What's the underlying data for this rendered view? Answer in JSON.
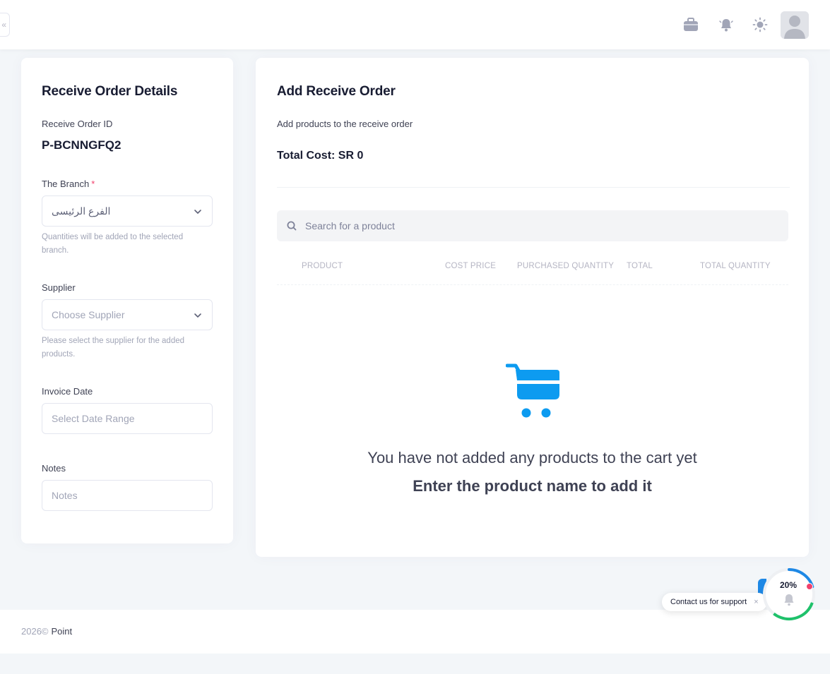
{
  "header": {
    "collapse_glyph": "«",
    "icons": [
      "briefcase-icon",
      "bell-icon",
      "sun-icon"
    ]
  },
  "details": {
    "title": "Receive Order Details",
    "order_id_label": "Receive Order ID",
    "order_id_value": "P-BCNNGFQ2",
    "branch_label": "The Branch",
    "branch_required": "*",
    "branch_value": "الفرع الرئيسى",
    "branch_hint": "Quantities will be added to the selected branch.",
    "supplier_label": "Supplier",
    "supplier_placeholder": "Choose Supplier",
    "supplier_hint": "Please select the supplier for the added products.",
    "invoice_label": "Invoice Date",
    "invoice_placeholder": "Select Date Range",
    "notes_label": "Notes",
    "notes_placeholder": "Notes"
  },
  "order": {
    "title": "Add Receive Order",
    "subtitle": "Add products to the receive order",
    "total_cost": "Total Cost: SR 0",
    "search_placeholder": "Search for a product",
    "columns": [
      "PRODUCT",
      "COST PRICE",
      "PURCHASED QUANTITY",
      "TOTAL",
      "TOTAL QUANTITY"
    ],
    "empty_message": "You have not added any products to the cart yet",
    "empty_cta": "Enter the product name to add it"
  },
  "footer": {
    "year": "2026©",
    "brand": "Point"
  },
  "support": {
    "label": "Contact us for support",
    "close": "×",
    "progress": "20%",
    "progress_value": 0.2
  },
  "colors": {
    "accent_blue": "#1e88e5",
    "cart_blue": "#0d9bf0",
    "progress_green": "#1fc16b",
    "alert_red": "#f1416c"
  }
}
